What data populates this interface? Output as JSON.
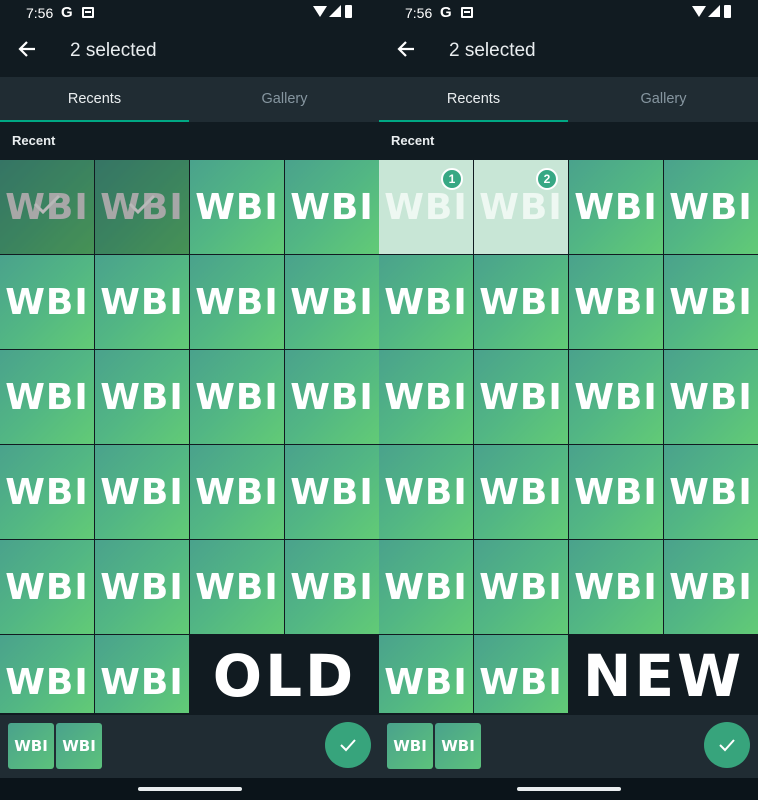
{
  "panels": [
    {
      "status": {
        "time": "7:56",
        "g": "G"
      },
      "title": "2 selected",
      "tabs": [
        {
          "label": "Recents"
        },
        {
          "label": "Gallery"
        }
      ],
      "section_label": "Recent",
      "tile_text": "WBI",
      "tag": "OLD",
      "selection_style": "checkmark",
      "selected_tiles": [
        0,
        1
      ]
    },
    {
      "status": {
        "time": "7:56",
        "g": "G"
      },
      "title": "2 selected",
      "tabs": [
        {
          "label": "Recents"
        },
        {
          "label": "Gallery"
        }
      ],
      "section_label": "Recent",
      "tile_text": "WBI",
      "tag": "NEW",
      "selection_style": "numbered",
      "selected_tiles": [
        0,
        1
      ],
      "selection_numbers": [
        "1",
        "2"
      ]
    }
  ],
  "thumbs": [
    "WBI",
    "WBI"
  ],
  "icons": {
    "back": "arrow-left-icon",
    "send": "check-icon",
    "g": "google-icon",
    "calendar": "calendar-icon",
    "wifi": "wifi-icon",
    "signal": "signal-icon",
    "battery": "battery-icon"
  },
  "colors": {
    "accent": "#00a884",
    "send_button": "#37a47c",
    "background": "#111b21",
    "bar": "#202c33"
  }
}
